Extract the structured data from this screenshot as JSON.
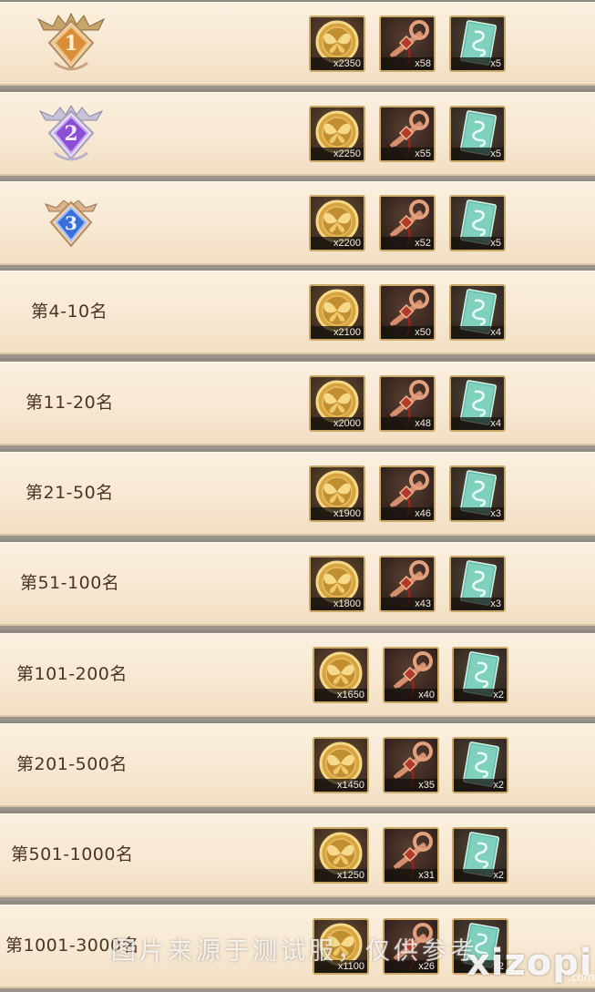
{
  "rows": [
    {
      "rank": "1",
      "rewards": [
        "x2350",
        "x58",
        "x5"
      ]
    },
    {
      "rank": "2",
      "rewards": [
        "x2250",
        "x55",
        "x5"
      ]
    },
    {
      "rank": "3",
      "rewards": [
        "x2200",
        "x52",
        "x5"
      ]
    },
    {
      "rank": "第4-10名",
      "rewards": [
        "x2100",
        "x50",
        "x4"
      ]
    },
    {
      "rank": "第11-20名",
      "rewards": [
        "x2000",
        "x48",
        "x4"
      ]
    },
    {
      "rank": "第21-50名",
      "rewards": [
        "x1900",
        "x46",
        "x3"
      ]
    },
    {
      "rank": "第51-100名",
      "rewards": [
        "x1800",
        "x43",
        "x3"
      ]
    },
    {
      "rank": "第101-200名",
      "rewards": [
        "x1650",
        "x40",
        "x2"
      ]
    },
    {
      "rank": "第201-500名",
      "rewards": [
        "x1450",
        "x35",
        "x2"
      ]
    },
    {
      "rank": "第501-1000名",
      "rewards": [
        "x1250",
        "x31",
        "x2"
      ]
    },
    {
      "rank": "第1001-3000名",
      "rewards": [
        "x1100",
        "x26",
        "x2"
      ]
    }
  ],
  "icons": [
    "butterfly-coin-icon",
    "bronze-key-icon",
    "jade-scroll-card-icon"
  ],
  "badge_colors": {
    "gold": "#e3a649",
    "purple": "#8a4fd6",
    "blue": "#3b6fd9"
  },
  "watermark": {
    "text": "图片来源于测试服，仅供参考",
    "logo": "xiz𝗼pi",
    "domain": ".com"
  }
}
